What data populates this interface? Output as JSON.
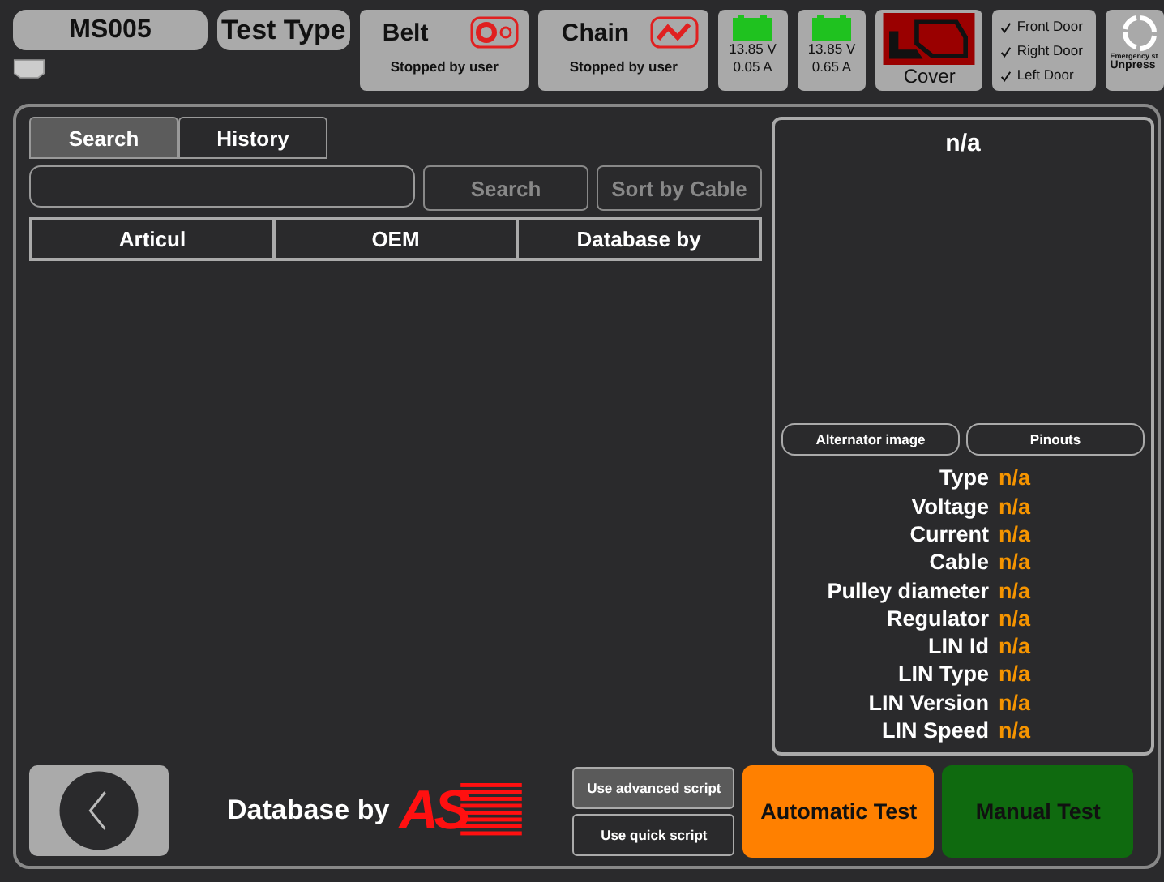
{
  "top_bar": {
    "device": "MS005",
    "test_type": "Test Type",
    "drives": [
      {
        "kind": "belt",
        "label": "Belt",
        "status": "Stopped by user"
      },
      {
        "kind": "chain",
        "label": "Chain",
        "status": "Stopped by user"
      }
    ],
    "batteries": [
      {
        "voltage": "13.85 V",
        "current": "0.05 A"
      },
      {
        "voltage": "13.85 V",
        "current": "0.65 A"
      }
    ],
    "cover": {
      "label": "Cover"
    },
    "doors": [
      {
        "label": "Front Door",
        "checked": true
      },
      {
        "label": "Right Door",
        "checked": true
      },
      {
        "label": "Left Door",
        "checked": true
      }
    ],
    "emergency": {
      "label": "Emergency st",
      "state": "Unpress"
    }
  },
  "tabs": [
    {
      "label": "Search",
      "selected": true
    },
    {
      "label": "History",
      "selected": false
    }
  ],
  "search": {
    "button": "Search",
    "sort_button": "Sort by Cable"
  },
  "table": {
    "columns": [
      "Articul",
      "OEM",
      "Database by"
    ]
  },
  "details": {
    "title": "n/a",
    "buttons": [
      "Alternator image",
      "Pinouts"
    ],
    "fields": [
      {
        "label": "Type",
        "value": "n/a"
      },
      {
        "label": "Voltage",
        "value": "n/a"
      },
      {
        "label": "Current",
        "value": "n/a"
      },
      {
        "label": "Cable",
        "value": "n/a"
      },
      {
        "label": "Pulley diameter",
        "value": "n/a"
      },
      {
        "label": "Regulator",
        "value": "n/a"
      },
      {
        "label": "LIN Id",
        "value": "n/a"
      },
      {
        "label": "LIN Type",
        "value": "n/a"
      },
      {
        "label": "LIN Version",
        "value": "n/a"
      },
      {
        "label": "LIN Speed",
        "value": "n/a"
      }
    ]
  },
  "footer": {
    "database_by": "Database by",
    "logo": "AS",
    "scripts": [
      {
        "label": "Use advanced script",
        "selected": true
      },
      {
        "label": "Use quick script",
        "selected": false
      }
    ],
    "automatic": "Automatic Test",
    "manual": "Manual Test"
  }
}
